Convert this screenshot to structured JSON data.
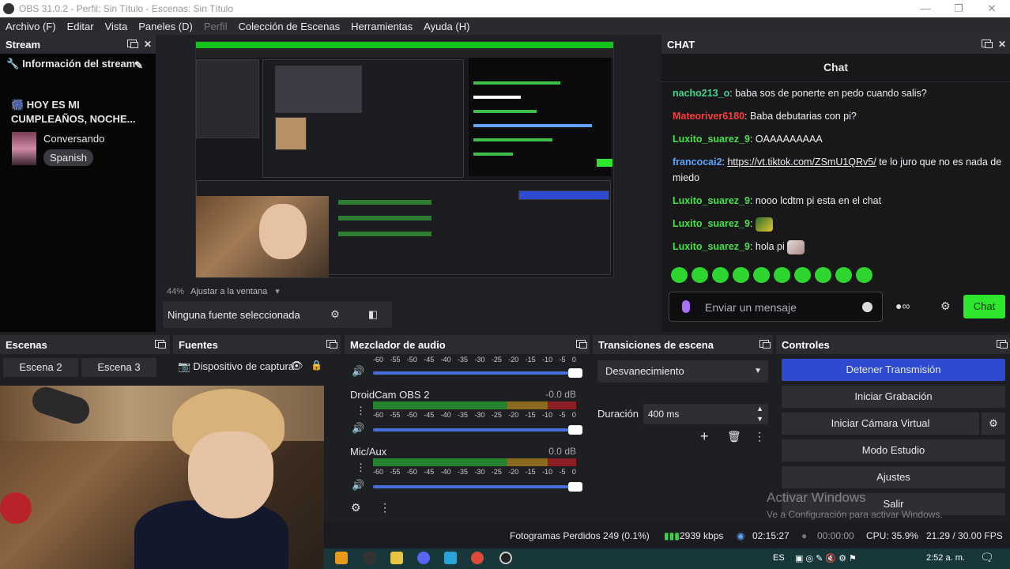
{
  "window": {
    "title": "OBS 31.0.2 - Perfil: Sin Título - Escenas: Sin Título"
  },
  "menu": [
    "Archivo (F)",
    "Editar",
    "Vista",
    "Paneles (D)",
    "Perfil",
    "Colección de Escenas",
    "Herramientas",
    "Ayuda (H)"
  ],
  "stream_dock": {
    "title": "Stream",
    "info_header": "Información del stream",
    "stream_title": "🎆 HOY ES MI CUMPLEAÑOS, NOCHE...",
    "category": "Conversando",
    "tag": "Spanish"
  },
  "preview": {
    "zoom": "44%",
    "zoom_mode": "Ajustar a la ventana",
    "no_source": "Ninguna fuente seleccionada"
  },
  "chat_dock": {
    "dock_title": "CHAT",
    "header": "Chat",
    "messages": [
      {
        "user": "nacho213_o",
        "color": "#3fd58a",
        "text": ": baba sos de ponerte en pedo cuando salis?"
      },
      {
        "user": "Mateoriver6180",
        "color": "#ff3b3b",
        "text": ": Baba debutarias con pi?"
      },
      {
        "user": "Luxito_suarez_9",
        "color": "#46e046",
        "text": ": OAAAAAAAAA"
      },
      {
        "user": "francocai2",
        "color": "#5aa5ff",
        "link": "https://vt.tiktok.com/ZSmU1QRv5/",
        "text": " te lo juro que no es nada de miedo"
      },
      {
        "user": "Luxito_suarez_9",
        "color": "#46e046",
        "text": ": nooo lcdtm pi esta en el chat"
      },
      {
        "user": "Luxito_suarez_9",
        "color": "#46e046",
        "text": ":"
      },
      {
        "user": "Luxito_suarez_9",
        "color": "#46e046",
        "text": ": hola pi"
      }
    ],
    "input_placeholder": "Enviar un mensaje",
    "send_label": "Chat"
  },
  "scenes": {
    "title": "Escenas",
    "items": [
      "Escena 2",
      "Escena 3"
    ]
  },
  "sources": {
    "title": "Fuentes",
    "items": [
      "Dispositivo de captura"
    ]
  },
  "mixer": {
    "title": "Mezclador de audio",
    "ticks": [
      "-60",
      "-55",
      "-50",
      "-45",
      "-40",
      "-35",
      "-30",
      "-25",
      "-20",
      "-15",
      "-10",
      "-5",
      "0"
    ],
    "channels": [
      {
        "name": "",
        "db": ""
      },
      {
        "name": "DroidCam OBS 2",
        "db": "-0.0 dB"
      },
      {
        "name": "Mic/Aux",
        "db": "0.0 dB"
      }
    ]
  },
  "transitions": {
    "title": "Transiciones de escena",
    "type": "Desvanecimiento",
    "duration_label": "Duración",
    "duration": "400 ms"
  },
  "controls": {
    "title": "Controles",
    "buttons": [
      "Detener Transmisión",
      "Iniciar Grabación",
      "Iniciar Cámara Virtual",
      "Modo Estudio",
      "Ajustes",
      "Salir"
    ]
  },
  "status": {
    "dropped": "Fotogramas Perdidos 249 (0.1%)",
    "bitrate": "2939 kbps",
    "stream_time": "02:15:27",
    "rec_time": "00:00:00",
    "cpu": "CPU: 35.9%",
    "fps": "21.29 / 30.00 FPS"
  },
  "taskbar": {
    "lang": "ES",
    "time": "2:52 a. m."
  },
  "watermark": {
    "line1": "Activar Windows",
    "line2": "Ve a Configuración para activar Windows."
  },
  "colors": {
    "accent_green": "#2ee62e",
    "control_primary": "#2d4ad0"
  }
}
